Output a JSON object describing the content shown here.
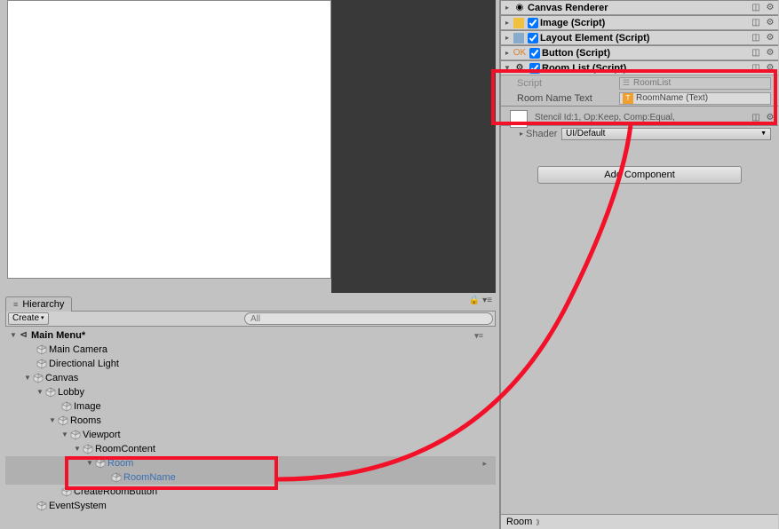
{
  "hierarchy": {
    "tab_label": "Hierarchy",
    "create_label": "Create",
    "search_placeholder": "All",
    "scene_name": "Main Menu*",
    "items": [
      {
        "label": "Main Camera"
      },
      {
        "label": "Directional Light"
      },
      {
        "label": "Canvas"
      },
      {
        "label": "Lobby"
      },
      {
        "label": "Image"
      },
      {
        "label": "Rooms"
      },
      {
        "label": "Viewport"
      },
      {
        "label": "RoomContent"
      },
      {
        "label": "Room"
      },
      {
        "label": "RoomName"
      },
      {
        "label": "CreateRoomButton"
      },
      {
        "label": "EventSystem"
      }
    ]
  },
  "inspector": {
    "components": [
      {
        "title": "Canvas Renderer"
      },
      {
        "title": "Image (Script)"
      },
      {
        "title": "Layout Element (Script)"
      },
      {
        "title": "Button (Script)"
      },
      {
        "title": "Room List (Script)"
      }
    ],
    "script_label": "Script",
    "script_value": "RoomList",
    "room_name_text_label": "Room Name Text",
    "room_name_text_value": "RoomName (Text)",
    "material_desc": "Stencil Id:1, Op:Keep, Comp:Equal,",
    "shader_label": "Shader",
    "shader_value": "UI/Default",
    "add_component": "Add Component",
    "breadcrumb": "Room"
  }
}
